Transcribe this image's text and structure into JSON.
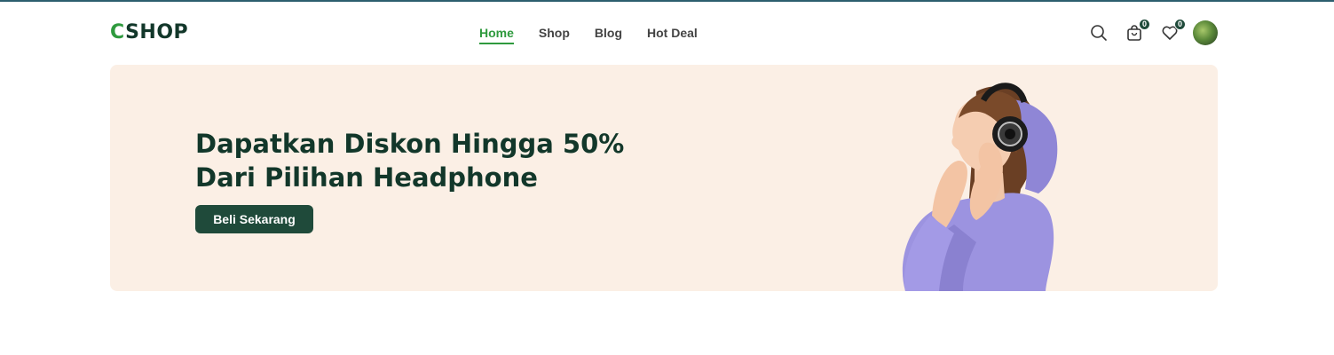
{
  "brand": {
    "logo_first": "C",
    "logo_rest": "SHOP"
  },
  "nav": {
    "items": [
      {
        "label": "Home",
        "active": true
      },
      {
        "label": "Shop",
        "active": false
      },
      {
        "label": "Blog",
        "active": false
      },
      {
        "label": "Hot Deal",
        "active": false
      }
    ]
  },
  "header_icons": {
    "search": "search-icon",
    "cart": {
      "icon": "shopping-bag-icon",
      "count": "0"
    },
    "wishlist": {
      "icon": "heart-icon",
      "count": "0"
    },
    "avatar": "user-avatar"
  },
  "banner": {
    "headline": "Dapatkan Diskon Hingga 50% Dari Pilihan Headphone",
    "cta_label": "Beli Sekarang",
    "image": "woman-wearing-headphones-purple-hoodie"
  },
  "colors": {
    "brand_dark": "#12372a",
    "brand_green": "#2f9a3e",
    "button_bg": "#1f4a3a",
    "banner_bg": "#fbefe5"
  }
}
